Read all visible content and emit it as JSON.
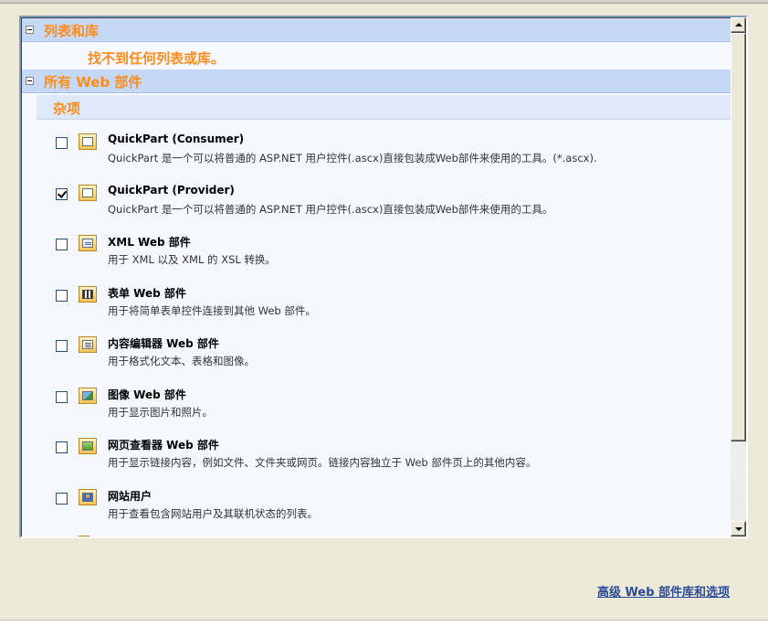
{
  "sections": {
    "lists": {
      "title": "列表和库",
      "empty_message": "找不到任何列表或库。"
    },
    "all_web_parts": {
      "title": "所有 Web 部件",
      "category": "杂项"
    }
  },
  "parts": [
    {
      "name": "QuickPart (Consumer)",
      "desc": "QuickPart 是一个可以将普通的 ASP.NET 用户控件(.ascx)直接包装成Web部件来使用的工具。(*.ascx).",
      "checked": false,
      "icon": "quickpart-icon"
    },
    {
      "name": "QuickPart (Provider)",
      "desc": "QuickPart 是一个可以将普通的 ASP.NET 用户控件(.ascx)直接包装成Web部件来使用的工具。",
      "checked": true,
      "icon": "quickpart-icon"
    },
    {
      "name": "XML Web 部件",
      "desc": "用于 XML 以及 XML 的 XSL 转换。",
      "checked": false,
      "icon": "xml-icon"
    },
    {
      "name": "表单 Web 部件",
      "desc": "用于将简单表单控件连接到其他 Web 部件。",
      "checked": false,
      "icon": "form-icon"
    },
    {
      "name": "内容编辑器 Web 部件",
      "desc": "用于格式化文本、表格和图像。",
      "checked": false,
      "icon": "content-editor-icon"
    },
    {
      "name": "图像 Web 部件",
      "desc": "用于显示图片和照片。",
      "checked": false,
      "icon": "image-icon"
    },
    {
      "name": "网页查看器 Web 部件",
      "desc": "用于显示链接内容，例如文件、文件夹或网页。链接内容独立于 Web 部件页上的其他内容。",
      "checked": false,
      "icon": "page-viewer-icon"
    },
    {
      "name": "网站用户",
      "desc": "用于查看包含网站用户及其联机状态的列表。",
      "checked": false,
      "icon": "site-users-icon"
    }
  ],
  "footer": {
    "advanced_link": "高级 Web 部件库和选项"
  },
  "colors": {
    "section_header_bg": "#c5d9f6",
    "title_orange": "#ff8c1a",
    "link_blue": "#2b4a9a"
  }
}
